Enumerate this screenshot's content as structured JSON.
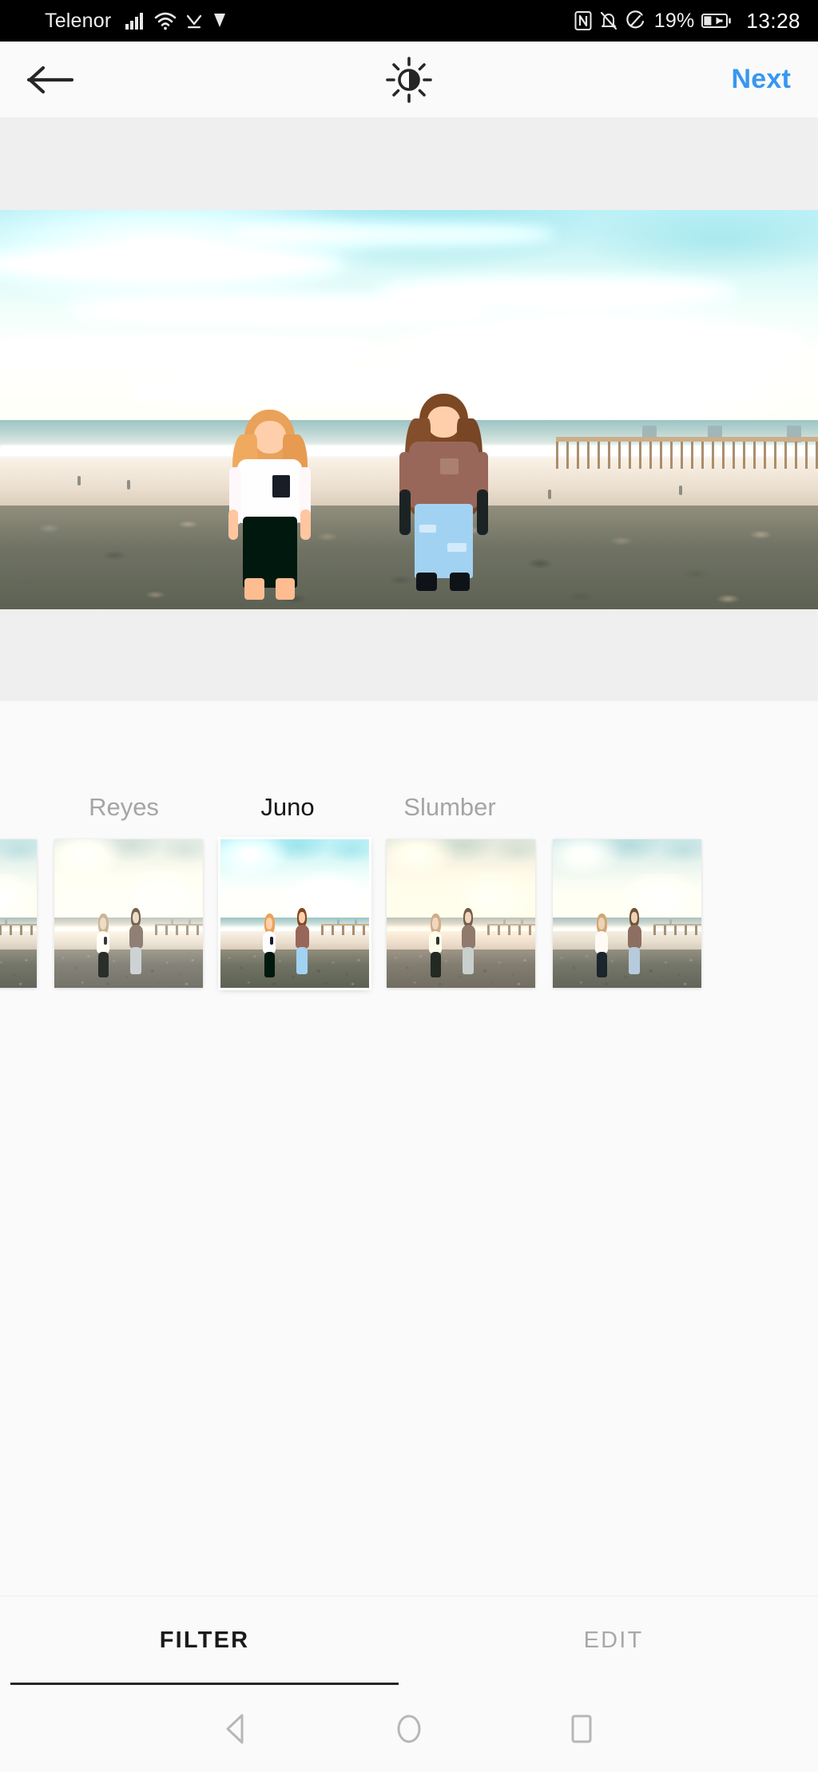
{
  "status_bar": {
    "carrier": "Telenor",
    "battery_percent": "19%",
    "time": "13:28",
    "icons": [
      "signal-bars-icon",
      "wifi-icon",
      "download-icon",
      "vpn-icon",
      "nfc-icon",
      "notifications-silenced-icon",
      "data-saver-icon",
      "battery-charging-icon"
    ]
  },
  "nav_bar": {
    "back_label": "back-arrow-icon",
    "lux_label": "lux-icon",
    "next_label": "Next",
    "next_color": "#3897f0"
  },
  "editor": {
    "photo_alt": "Two women walking on a pebble beach with ocean and pier",
    "background_color": "#efefef"
  },
  "filters": {
    "selected": "Juno",
    "items": [
      {
        "name": "",
        "label_visible": false,
        "style": "f-normal",
        "partial": "left"
      },
      {
        "name": "Reyes",
        "label_visible": true,
        "style": "f-reyes",
        "partial": ""
      },
      {
        "name": "Juno",
        "label_visible": true,
        "style": "f-juno",
        "partial": ""
      },
      {
        "name": "Slumber",
        "label_visible": true,
        "style": "f-slumber",
        "partial": ""
      },
      {
        "name": "",
        "label_visible": false,
        "style": "f-normal",
        "partial": "right"
      }
    ]
  },
  "tabs": {
    "items": [
      {
        "label": "FILTER",
        "active": true
      },
      {
        "label": "EDIT",
        "active": false
      }
    ]
  },
  "android_nav": {
    "back": "android-back-icon",
    "home": "android-home-icon",
    "recents": "android-recents-icon"
  }
}
